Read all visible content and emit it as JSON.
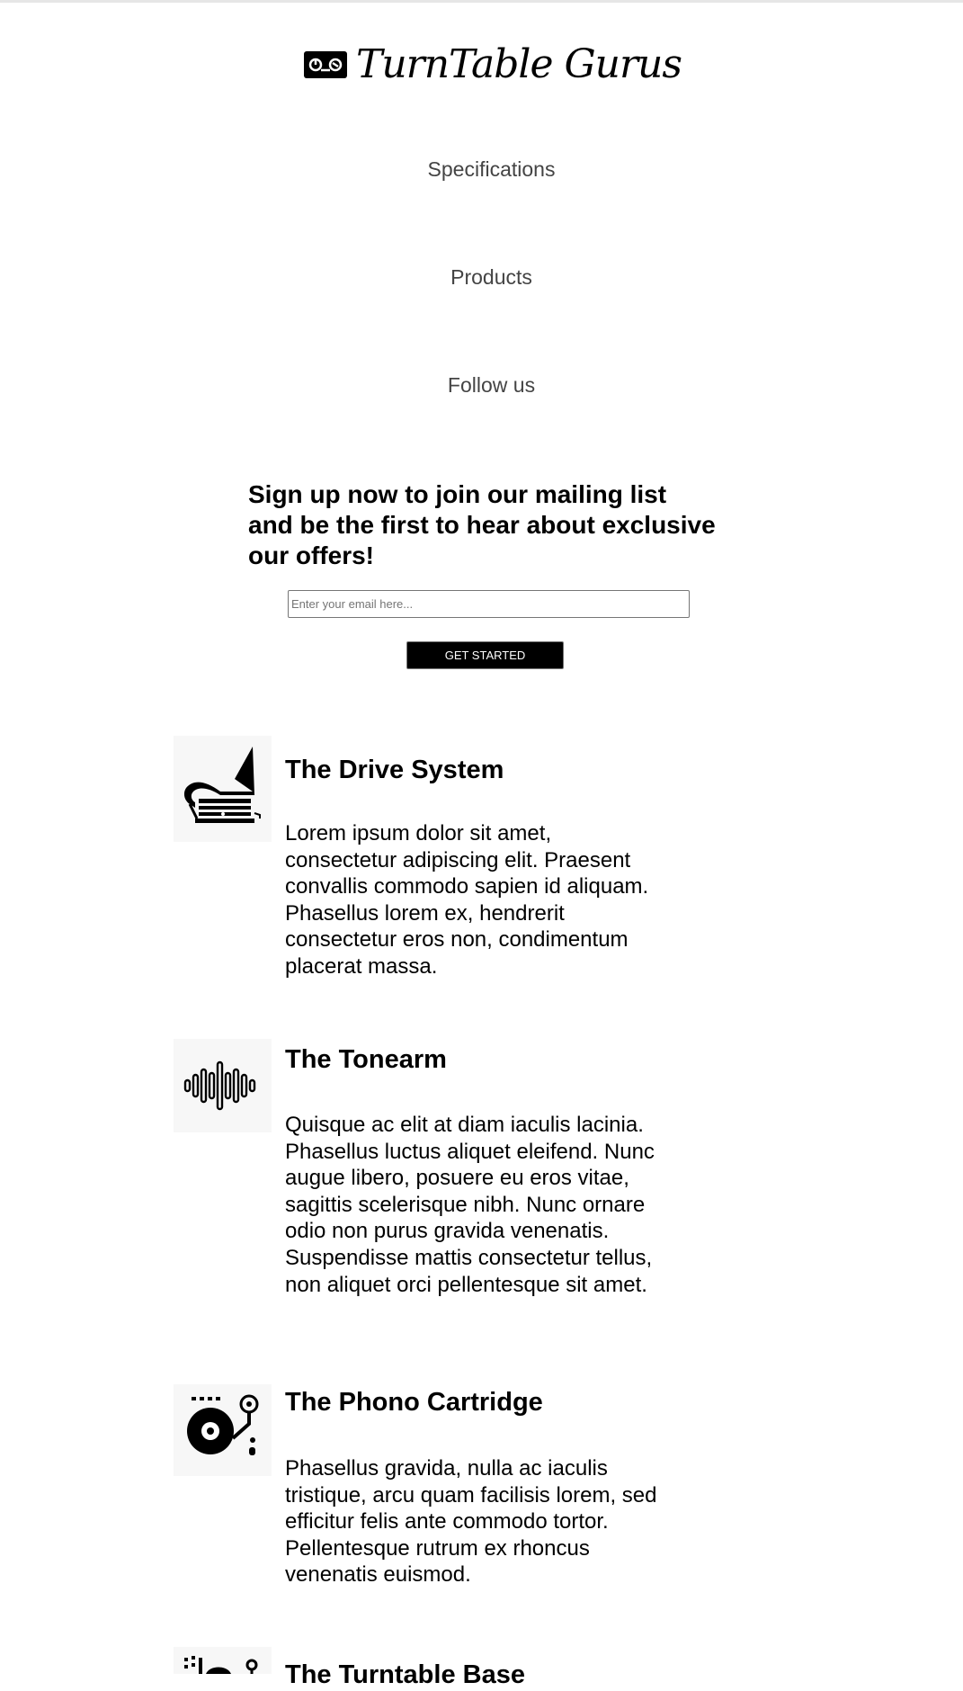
{
  "header": {
    "brand_name": "TurnTable Gurus",
    "brand_icon": "cassette-tape-icon"
  },
  "nav": {
    "items": [
      {
        "label": "Specifications"
      },
      {
        "label": "Products"
      },
      {
        "label": "Follow us"
      }
    ]
  },
  "signup": {
    "heading": "Sign up now to join our mailing list and be the first to hear about exclusive our offers!",
    "email_placeholder": "Enter your email here...",
    "email_value": "",
    "button_label": "Get Started"
  },
  "features": [
    {
      "icon": "gramophone-icon",
      "title": "The Drive System",
      "text": "Lorem ipsum dolor sit amet, consectetur adipiscing elit. Praesent convallis commodo sapien id aliquam. Phasellus lorem ex, hendrerit consectetur eros non, condimentum placerat massa."
    },
    {
      "icon": "sound-wave-icon",
      "title": "The Tonearm",
      "text": "Quisque ac elit at diam iaculis lacinia. Phasellus luctus aliquet eleifend. Nunc augue libero, posuere eu eros vitae, sagittis scelerisque nibh. Nunc ornare odio non purus gravida venenatis. Suspendisse mattis consectetur tellus, non aliquet orci pellentesque sit amet."
    },
    {
      "icon": "turntable-icon",
      "title": "The Phono Cartridge",
      "text": "Phasellus gravida, nulla ac iaculis tristique, arcu quam facilisis lorem, sed efficitur felis ante commodo tortor. Pellentesque rutrum ex rhoncus venenatis euismod."
    },
    {
      "icon": "dj-mixer-icon",
      "title": "The Turntable Base",
      "text": ""
    }
  ],
  "colors": {
    "page_background": "#ffffff",
    "nav_text": "#444444",
    "button_background": "#000000",
    "button_text": "#ffffff",
    "icon_tile_background": "#f7f7f7"
  }
}
